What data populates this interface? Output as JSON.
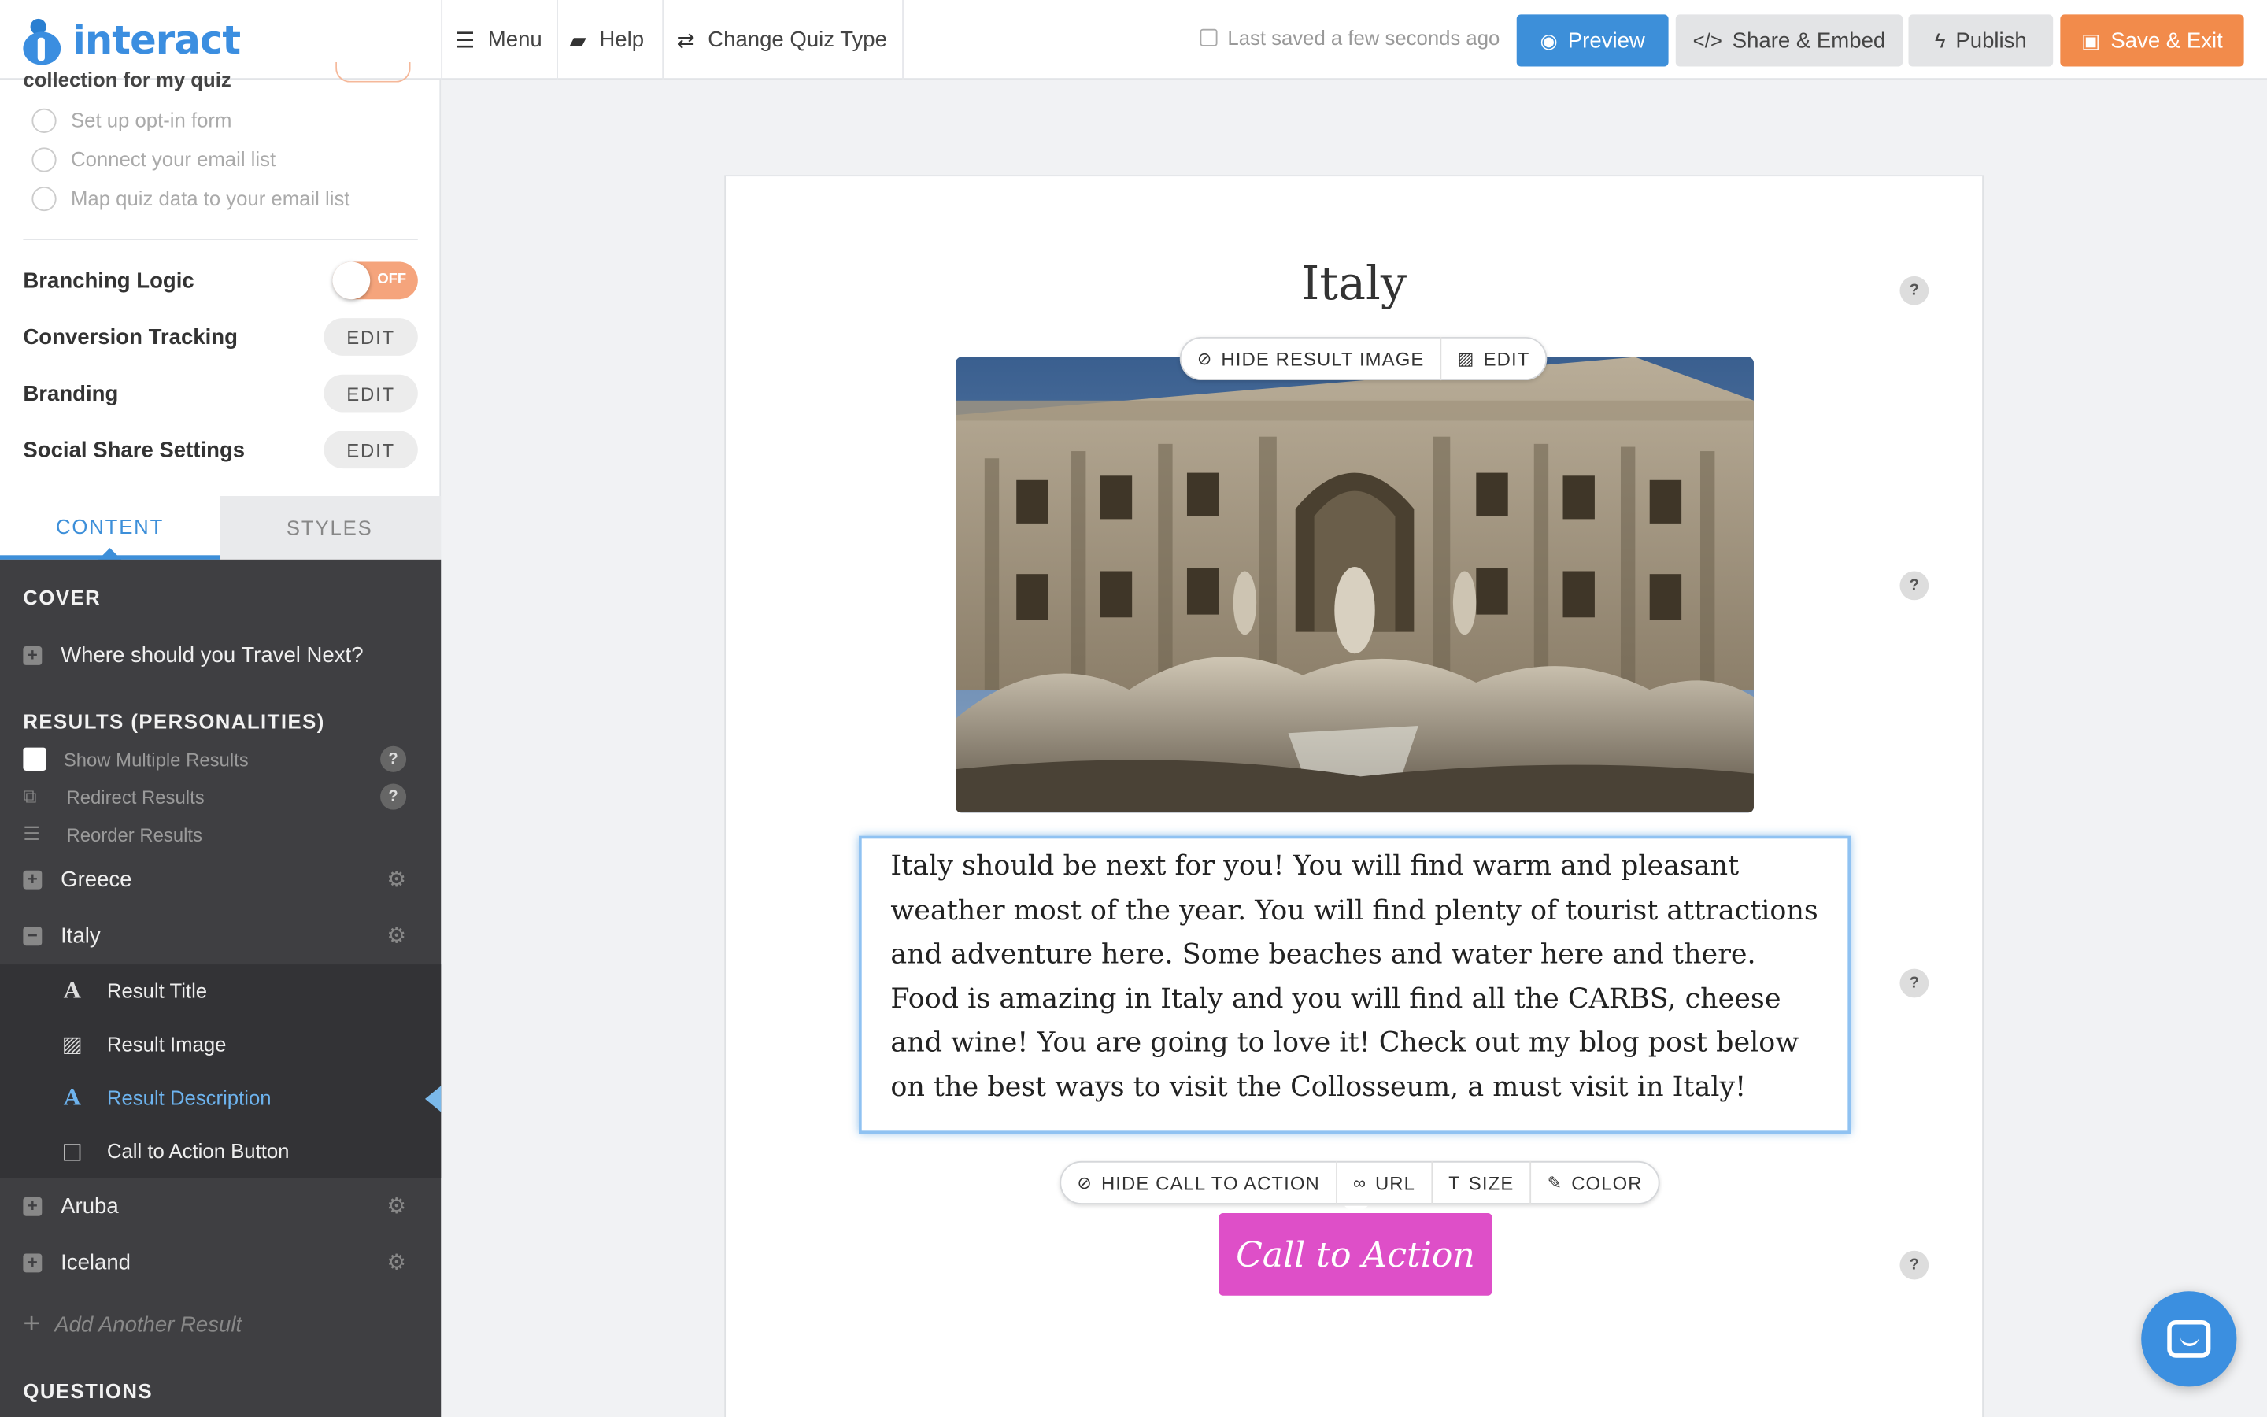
{
  "app": {
    "logo_text": "interact",
    "brand_color": "#3b8ee0"
  },
  "nav": {
    "menu": "Menu",
    "help": "Help",
    "change_quiz_type": "Change Quiz Type"
  },
  "status": {
    "saved": "Last saved a few seconds ago"
  },
  "actions": {
    "preview": "Preview",
    "share": "Share & Embed",
    "publish": "Publish",
    "save_exit": "Save & Exit",
    "preview_color": "#3d8fd9",
    "save_color": "#f28b4b"
  },
  "sidebar": {
    "cut_heading": "collection for my quiz",
    "optin_steps": [
      "Set up opt-in form",
      "Connect your email list",
      "Map quiz data to your email list"
    ],
    "settings": {
      "branching": {
        "label": "Branching Logic",
        "toggle": "OFF"
      },
      "conversion": {
        "label": "Conversion Tracking",
        "action": "EDIT"
      },
      "branding": {
        "label": "Branding",
        "action": "EDIT"
      },
      "social": {
        "label": "Social Share Settings",
        "action": "EDIT"
      }
    },
    "tabs": {
      "content": "CONTENT",
      "styles": "STYLES"
    },
    "cover": {
      "heading": "COVER",
      "item": "Where should you Travel Next?"
    },
    "results": {
      "heading": "RESULTS (PERSONALITIES)",
      "show_multiple": "Show Multiple Results",
      "redirect": "Redirect Results",
      "reorder": "Reorder Results",
      "items": [
        "Greece",
        "Italy",
        "Aruba",
        "Iceland"
      ],
      "italy_children": [
        "Result Title",
        "Result Image",
        "Result Description",
        "Call to Action Button"
      ],
      "add": "Add Another Result"
    },
    "questions_heading": "QUESTIONS"
  },
  "canvas": {
    "title": "Italy",
    "image_bar": {
      "hide": "HIDE RESULT IMAGE",
      "edit": "EDIT"
    },
    "description": "Italy should be next for you! You will find warm and pleasant weather most of the year. You will find plenty of tourist attractions and adventure here. Some beaches and water here and there. Food is amazing in Italy and you will find all the CARBS, cheese and wine! You are going to love it! Check out my blog post below on the best ways to visit the Collosseum, a must visit in Italy!",
    "cta_bar": {
      "hide": "HIDE CALL TO ACTION",
      "url": "URL",
      "size": "SIZE",
      "color": "COLOR"
    },
    "cta": "Call to Action",
    "cta_color": "#de4fc8",
    "help_glyph": "?"
  }
}
